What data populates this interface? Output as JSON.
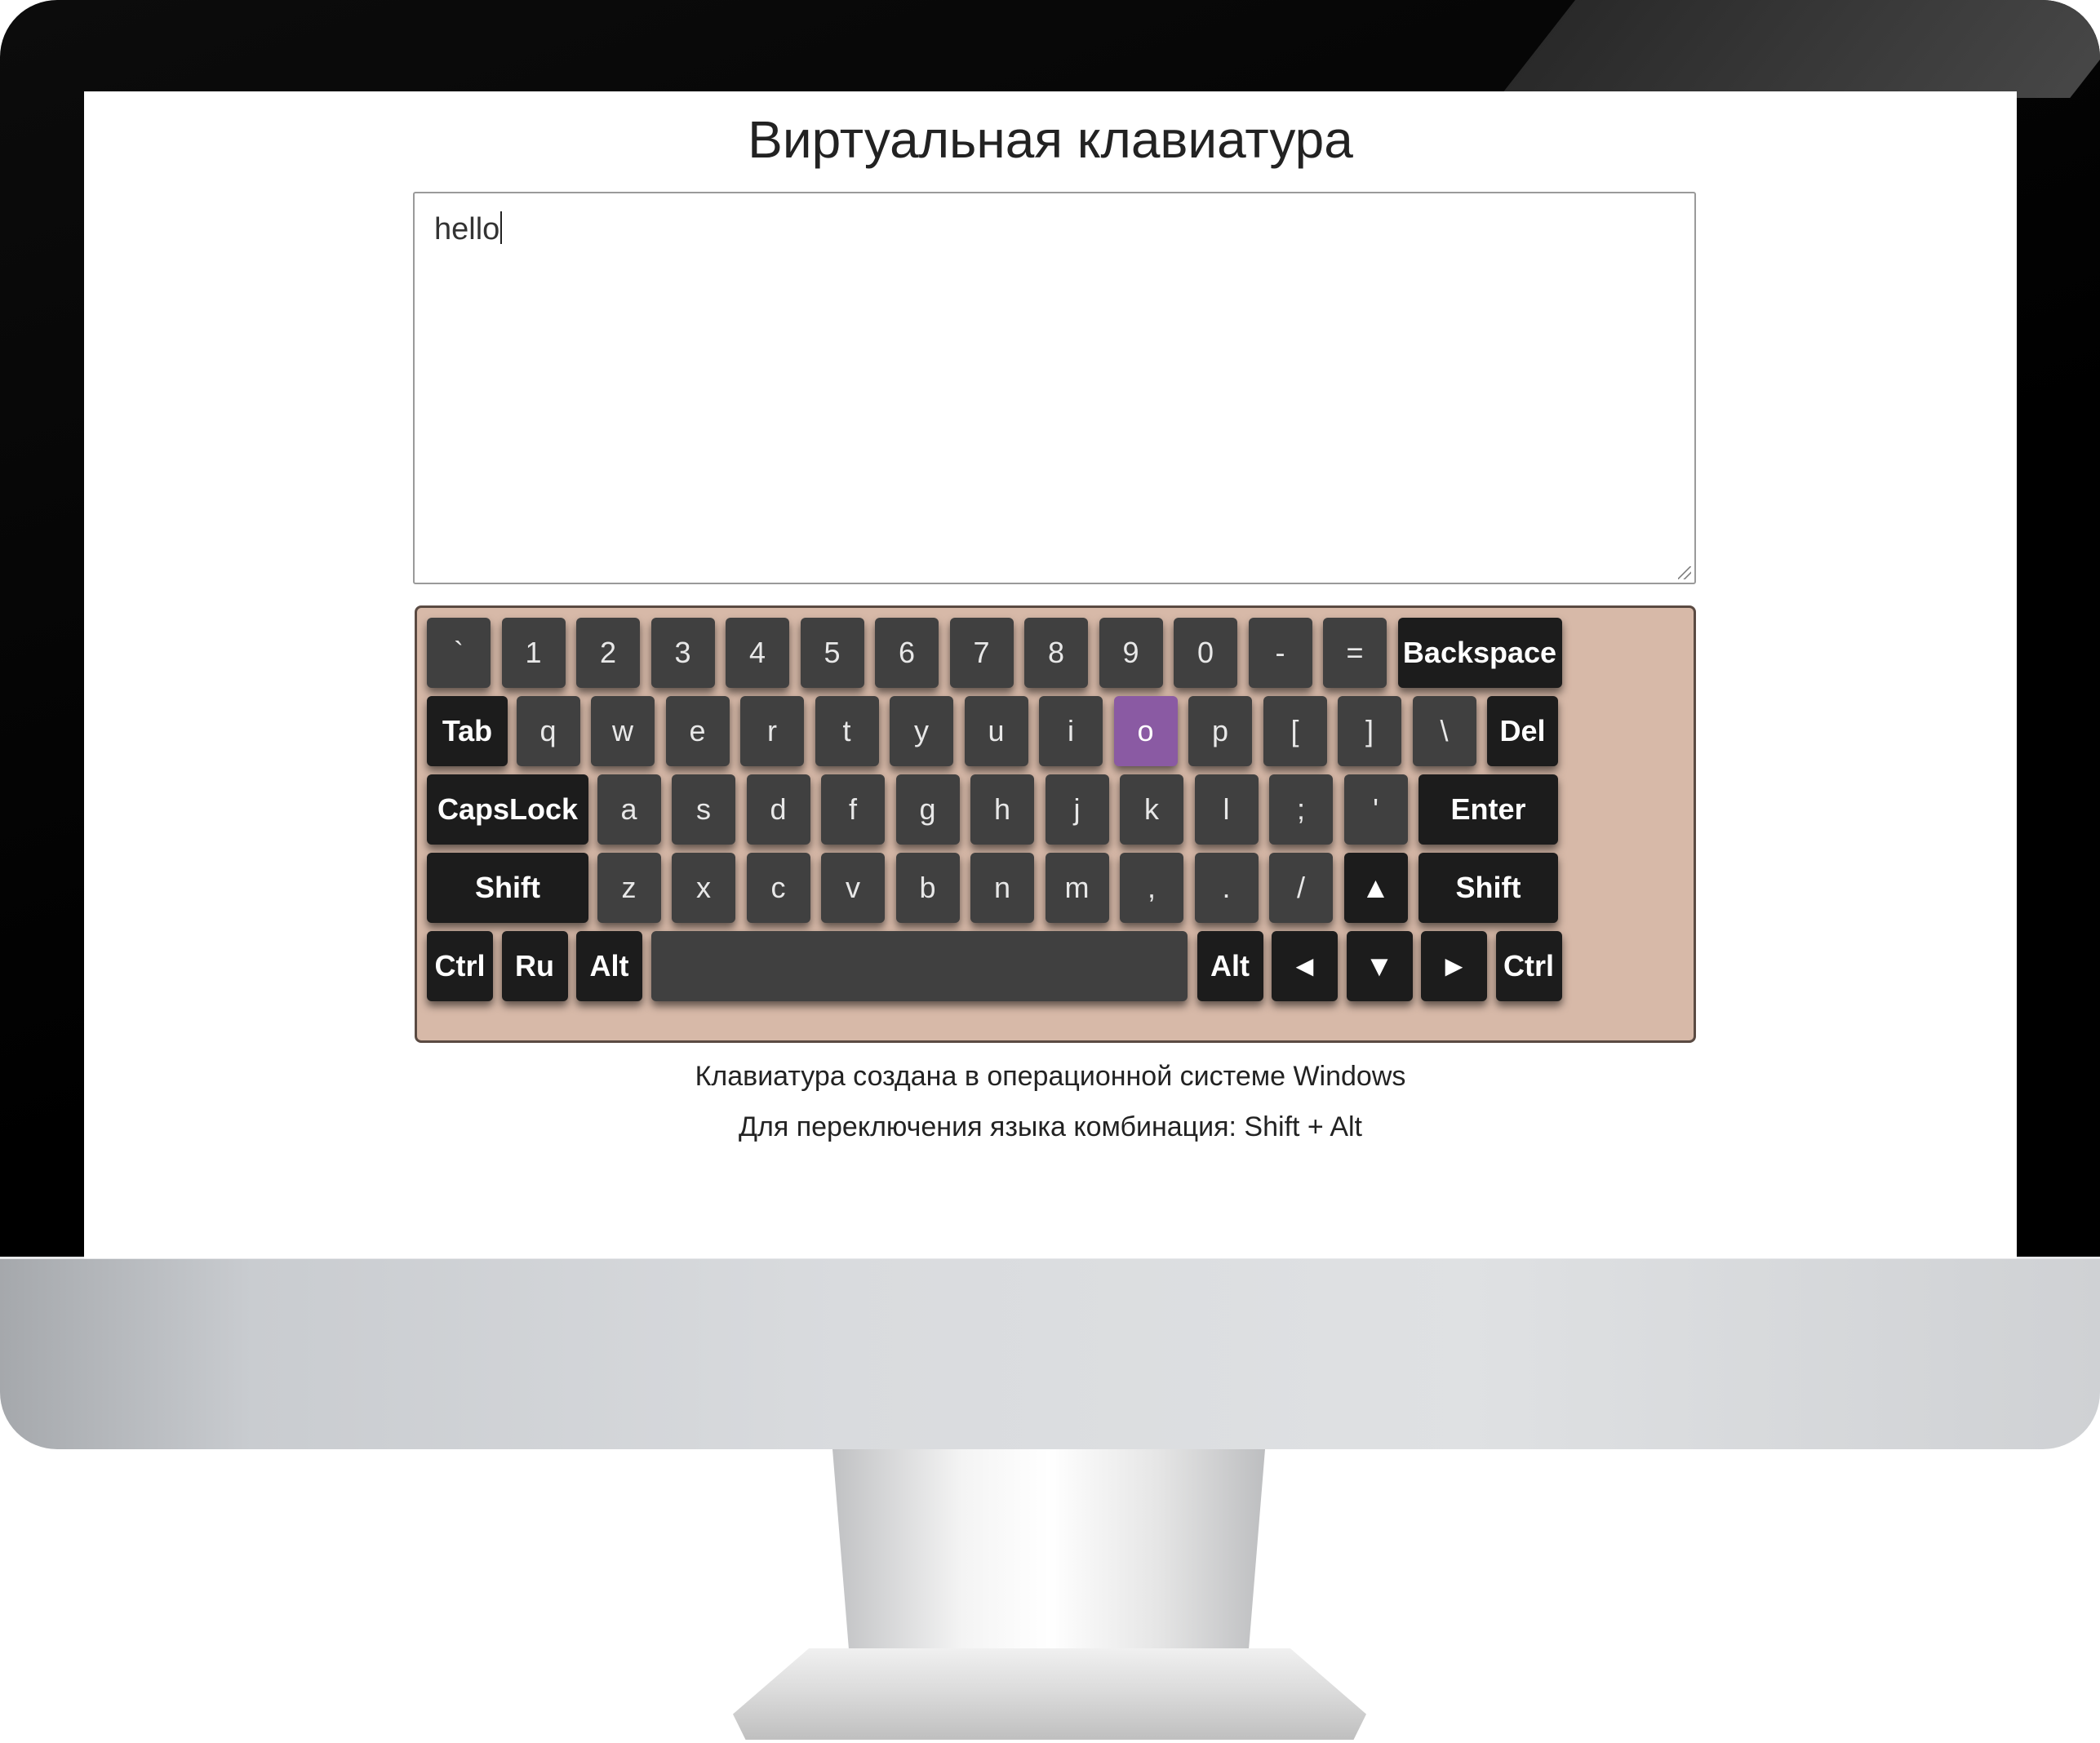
{
  "title": "Виртуальная клавиатура",
  "textarea": {
    "value": "hello"
  },
  "keyboard": {
    "colors": {
      "frame": "#d7b9a8",
      "key": "#404040",
      "special_key": "#1c1c1c",
      "active_key": "#8a5aa3"
    },
    "active_key": "o",
    "rows": [
      [
        {
          "label": "`"
        },
        {
          "label": "1"
        },
        {
          "label": "2"
        },
        {
          "label": "3"
        },
        {
          "label": "4"
        },
        {
          "label": "5"
        },
        {
          "label": "6"
        },
        {
          "label": "7"
        },
        {
          "label": "8"
        },
        {
          "label": "9"
        },
        {
          "label": "0"
        },
        {
          "label": "-"
        },
        {
          "label": "="
        },
        {
          "label": "Backspace",
          "special": true
        }
      ],
      [
        {
          "label": "Tab",
          "special": true
        },
        {
          "label": "q"
        },
        {
          "label": "w"
        },
        {
          "label": "e"
        },
        {
          "label": "r"
        },
        {
          "label": "t"
        },
        {
          "label": "y"
        },
        {
          "label": "u"
        },
        {
          "label": "i"
        },
        {
          "label": "o"
        },
        {
          "label": "p"
        },
        {
          "label": "["
        },
        {
          "label": "]"
        },
        {
          "label": "\\"
        },
        {
          "label": "Del",
          "special": true
        }
      ],
      [
        {
          "label": "CapsLock",
          "special": true
        },
        {
          "label": "a"
        },
        {
          "label": "s"
        },
        {
          "label": "d"
        },
        {
          "label": "f"
        },
        {
          "label": "g"
        },
        {
          "label": "h"
        },
        {
          "label": "j"
        },
        {
          "label": "k"
        },
        {
          "label": "l"
        },
        {
          "label": ";"
        },
        {
          "label": "'"
        },
        {
          "label": "Enter",
          "special": true
        }
      ],
      [
        {
          "label": "Shift",
          "special": true
        },
        {
          "label": "z"
        },
        {
          "label": "x"
        },
        {
          "label": "c"
        },
        {
          "label": "v"
        },
        {
          "label": "b"
        },
        {
          "label": "n"
        },
        {
          "label": "m"
        },
        {
          "label": ","
        },
        {
          "label": "."
        },
        {
          "label": "/"
        },
        {
          "label": "▲",
          "special": true
        },
        {
          "label": "Shift",
          "special": true
        }
      ],
      [
        {
          "label": "Ctrl",
          "special": true
        },
        {
          "label": "Ru",
          "special": true
        },
        {
          "label": "Alt",
          "special": true
        },
        {
          "label": ""
        },
        {
          "label": "Alt",
          "special": true
        },
        {
          "label": "◄",
          "special": true
        },
        {
          "label": "▼",
          "special": true
        },
        {
          "label": "►",
          "special": true
        },
        {
          "label": "Ctrl",
          "special": true
        }
      ]
    ]
  },
  "notes": {
    "line1": "Клавиатура создана в операционной системе Windows",
    "line2": "Для переключения языка комбинация: Shift + Alt"
  }
}
